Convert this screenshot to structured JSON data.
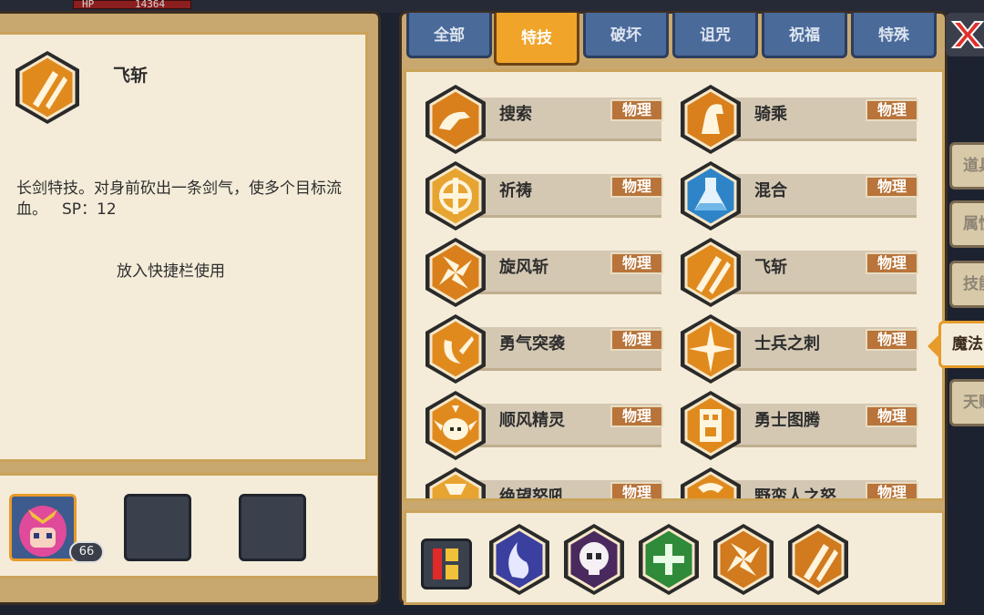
{
  "hud": {
    "hp_label": "HP",
    "hp_value": "14364"
  },
  "detail": {
    "icon": "flying-slash-icon",
    "name": "飞斩",
    "description": "长剑特技。对身前砍出一条剑气，使多个目标流血。",
    "sp": "SP：12",
    "action": "放入快捷栏使用"
  },
  "hero": {
    "level": "66",
    "icon": "pink-haired-hero-avatar"
  },
  "tabs": [
    {
      "label": "全部",
      "active": false
    },
    {
      "label": "特技",
      "active": true
    },
    {
      "label": "破坏",
      "active": false
    },
    {
      "label": "诅咒",
      "active": false
    },
    {
      "label": "祝福",
      "active": false
    },
    {
      "label": "特殊",
      "active": false
    }
  ],
  "skills": [
    {
      "name": "搜索",
      "tag": "物理",
      "icon": "search-icon"
    },
    {
      "name": "骑乘",
      "tag": "物理",
      "icon": "horse-icon"
    },
    {
      "name": "祈祷",
      "tag": "物理",
      "icon": "cross-icon"
    },
    {
      "name": "混合",
      "tag": "物理",
      "icon": "flask-icon"
    },
    {
      "name": "旋风斩",
      "tag": "物理",
      "icon": "whirlwind-icon"
    },
    {
      "name": "飞斩",
      "tag": "物理",
      "icon": "flying-slash-icon"
    },
    {
      "name": "勇气突袭",
      "tag": "物理",
      "icon": "courage-strike-icon"
    },
    {
      "name": "士兵之刺",
      "tag": "物理",
      "icon": "soldier-thrust-icon"
    },
    {
      "name": "顺风精灵",
      "tag": "物理",
      "icon": "wind-spirit-icon"
    },
    {
      "name": "勇士图腾",
      "tag": "物理",
      "icon": "warrior-totem-icon"
    },
    {
      "name": "绝望怒吼",
      "tag": "物理",
      "icon": "despair-roar-icon"
    },
    {
      "name": "野蛮人之怒",
      "tag": "物理",
      "icon": "barbarian-rage-icon"
    }
  ],
  "quickbar": {
    "number_button": "123",
    "items": [
      {
        "icon": "blue-flame-icon",
        "color": "#3a3fa0"
      },
      {
        "icon": "skull-icon",
        "color": "#4a2a5e"
      },
      {
        "icon": "green-cross-icon",
        "color": "#2f8a3a"
      },
      {
        "icon": "whirlwind-icon",
        "color": "#d17a1e"
      },
      {
        "icon": "flying-slash-icon",
        "color": "#d17a1e"
      }
    ]
  },
  "side_tabs": [
    {
      "label": "道具",
      "active": false
    },
    {
      "label": "属性",
      "active": false
    },
    {
      "label": "技能",
      "active": false
    },
    {
      "label": "魔法",
      "active": true
    },
    {
      "label": "天赋",
      "active": false
    }
  ],
  "colors": {
    "accent": "#f0a42a",
    "panel": "#f4ecd9",
    "tab_blue": "#4a6a9a",
    "tag": "#b8743a"
  }
}
